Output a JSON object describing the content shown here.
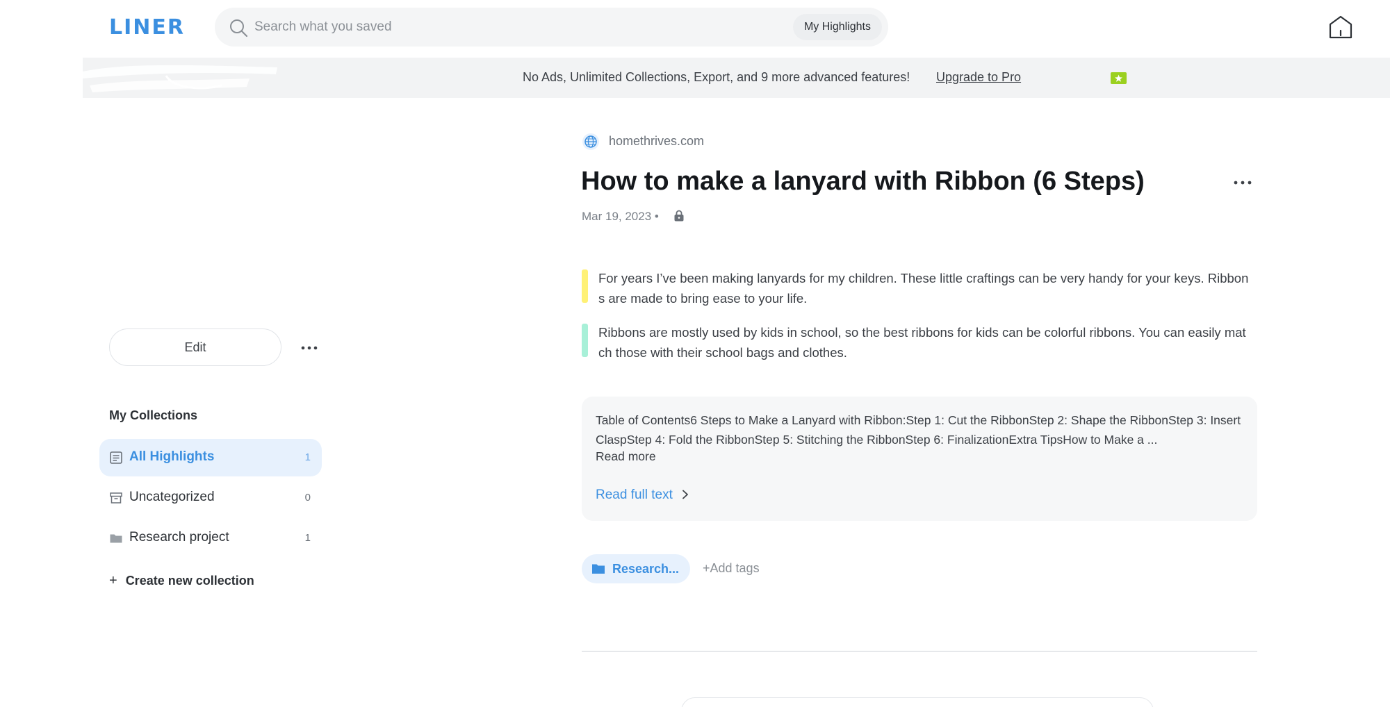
{
  "app": {
    "logo": "LINER"
  },
  "search": {
    "placeholder": "Search what you saved",
    "filter_label": "My Highlights"
  },
  "banner": {
    "text": "No Ads, Unlimited Collections, Export, and 9 more advanced features!",
    "upgrade_label": "Upgrade to Pro",
    "badge_color": "#9bd01f"
  },
  "sidebar": {
    "edit_label": "Edit",
    "collections_title": "My Collections",
    "collections": [
      {
        "label": "All Highlights",
        "count": "1",
        "icon": "list-icon",
        "active": true
      },
      {
        "label": "Uncategorized",
        "count": "0",
        "icon": "archive-box-icon",
        "active": false
      },
      {
        "label": "Research project",
        "count": "1",
        "icon": "folder-icon",
        "active": false
      }
    ],
    "create_label": "Create new collection",
    "create_symbol": "+"
  },
  "article": {
    "domain": "homethrives.com",
    "title": "How to make a lanyard with Ribbon (6 Steps)",
    "date": "Mar 19, 2023",
    "date_separator": "•",
    "highlights": [
      {
        "text": "For years I’ve been making lanyards for my children. These little craftings can be very handy for your keys. Ribbons are made to bring ease to your life.",
        "color": "#fff176"
      },
      {
        "text": "Ribbons are mostly used by kids in school, so the best ribbons for kids can be colorful ribbons. You can easily match those with their school bags and clothes.",
        "color": "#a8f0d8"
      }
    ],
    "toc_text": "Table of Contents6 Steps to Make a Lanyard with Ribbon:Step 1: Cut the RibbonStep 2: Shape the RibbonStep 3: Insert ClaspStep 4: Fold the RibbonStep 5: Stitching the RibbonStep 6: FinalizationExtra TipsHow to Make a ...",
    "read_more_label": "Read more",
    "read_full_label": "Read full text",
    "tag_label": "Research...",
    "add_tags_label": "+Add tags"
  },
  "colors": {
    "accent": "#3b8fe0",
    "active_bg": "#e7f1fd"
  }
}
